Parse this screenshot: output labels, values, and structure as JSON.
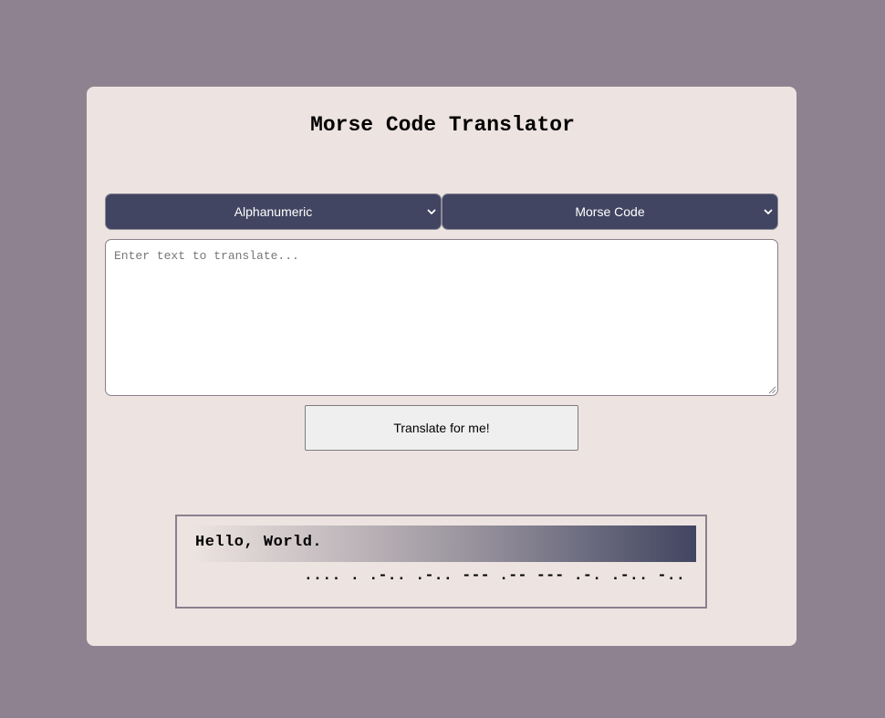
{
  "app": {
    "title": "Morse Code Translator"
  },
  "selectors": {
    "from": {
      "selected": "Alphanumeric",
      "icon": "chevron-down-icon"
    },
    "to": {
      "selected": "Morse Code",
      "icon": "chevron-down-icon"
    }
  },
  "input": {
    "placeholder": "Enter text to translate...",
    "value": ""
  },
  "actions": {
    "translate_label": "Translate for me!"
  },
  "result": {
    "text": "Hello, World.",
    "morse": ".... . .-.. .-.. --- .-- --- .-. .-.. -.."
  },
  "colors": {
    "page_background": "#8f8290",
    "card_background": "#ede4e1",
    "select_background": "#414561",
    "accent_gradient_end": "#414561"
  }
}
